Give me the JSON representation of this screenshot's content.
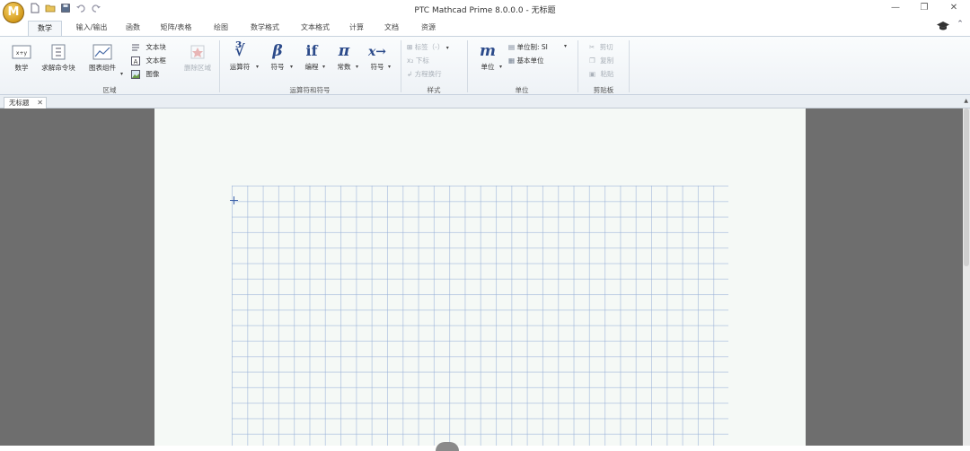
{
  "window": {
    "title": "PTC Mathcad Prime 8.0.0.0 - 无标题",
    "logo_letter": "M",
    "controls": {
      "minimize": "—",
      "restore": "❐",
      "close": "✕"
    }
  },
  "tabs": [
    {
      "label": "数学",
      "active": true
    },
    {
      "label": "输入/输出"
    },
    {
      "label": "函数"
    },
    {
      "label": "矩阵/表格"
    },
    {
      "label": "绘图"
    },
    {
      "label": "数学格式"
    },
    {
      "label": "文本格式"
    },
    {
      "label": "计算"
    },
    {
      "label": "文档"
    },
    {
      "label": "资源"
    }
  ],
  "ribbon": {
    "regions": {
      "label": "区域",
      "math": "数学",
      "solve_block": "求解命令块",
      "chart_component": "图表组件",
      "text_block": "文本块",
      "text_box": "文本框",
      "image": "图像",
      "delete_region": "删除区域"
    },
    "operators": {
      "label": "运算符和符号",
      "operators_btn": "运算符",
      "symbols_btn": "符号",
      "programming_btn": "编程",
      "constants_btn": "常数",
      "symbolics_btn": "符号",
      "icons": {
        "operators": "∛",
        "symbols": "β",
        "programming": "if",
        "constants": "π",
        "symbolics": "x→"
      }
    },
    "style": {
      "label": "样式",
      "label_dropdown": "标签（-）",
      "subscript": "下标",
      "matrix_label": "方程换行"
    },
    "units": {
      "label": "单位",
      "units_btn": "单位",
      "unit_system": "单位制: SI",
      "base_units": "基本单位",
      "icon": "m"
    },
    "clipboard": {
      "label": "剪贴板",
      "cut": "剪切",
      "copy": "复制",
      "paste": "粘贴"
    }
  },
  "document": {
    "tab_label": "无标题",
    "tab_close": "✕"
  },
  "colors": {
    "ribbon_bg": "#eef2f6",
    "workspace_bg": "#6e6e6e",
    "page_bg": "#f5f9f6",
    "grid_line": "#96afd7",
    "accent_blue": "#2b4a8a"
  }
}
